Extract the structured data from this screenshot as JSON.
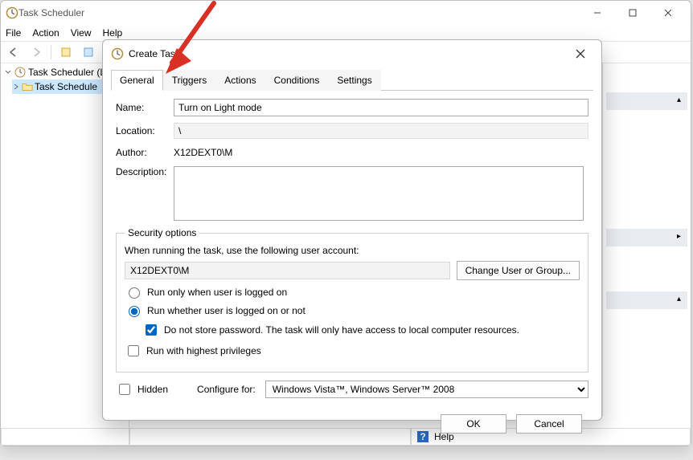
{
  "window": {
    "title": "Task Scheduler",
    "menus": [
      "File",
      "Action",
      "View",
      "Help"
    ],
    "tree": {
      "root": "Task Scheduler (L",
      "child": "Task Schedule"
    }
  },
  "status": {
    "help": "Help"
  },
  "dialog": {
    "title": "Create Task",
    "tabs": [
      "General",
      "Triggers",
      "Actions",
      "Conditions",
      "Settings"
    ],
    "fields": {
      "name_label": "Name:",
      "name_value": "Turn on Light mode",
      "location_label": "Location:",
      "location_value": "\\",
      "author_label": "Author:",
      "author_value": "X12DEXT0\\M",
      "desc_label": "Description:",
      "desc_value": ""
    },
    "security": {
      "legend": "Security options",
      "prompt": "When running the task, use the following user account:",
      "account": "X12DEXT0\\M",
      "change_btn": "Change User or Group...",
      "radio_logged_on": "Run only when user is logged on",
      "radio_whether": "Run whether user is logged on or not",
      "chk_nopass": "Do not store password.  The task will only have access to local computer resources.",
      "chk_highest": "Run with highest privileges"
    },
    "hidden_label": "Hidden",
    "configure_label": "Configure for:",
    "configure_value": "Windows Vista™, Windows Server™ 2008",
    "ok": "OK",
    "cancel": "Cancel"
  }
}
